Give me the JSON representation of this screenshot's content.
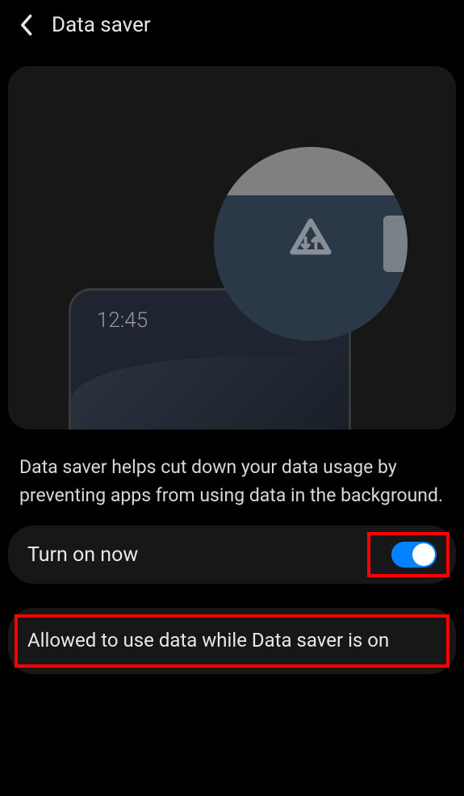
{
  "header": {
    "title": "Data saver"
  },
  "illustration": {
    "phone_time": "12:45"
  },
  "description": "Data saver helps cut down your data usage by preventing apps from using data in the background.",
  "toggle": {
    "label": "Turn on now",
    "enabled": true
  },
  "option": {
    "label": "Allowed to use data while Data saver is on"
  }
}
